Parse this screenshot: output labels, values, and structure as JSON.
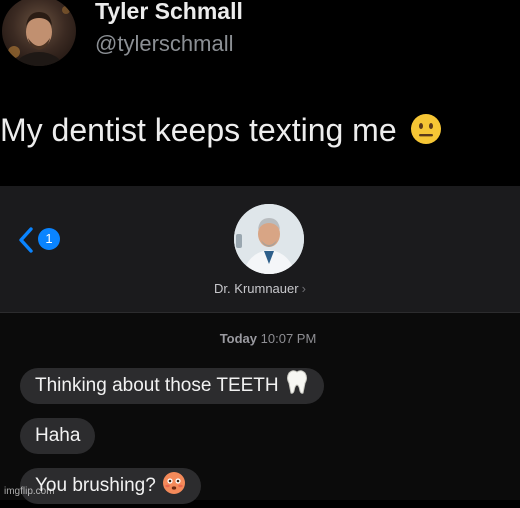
{
  "tweet": {
    "author_name": "Tyler Schmall",
    "author_handle": "@tylerschmall",
    "text": "My dentist keeps texting me",
    "emoji": "neutral-face-icon"
  },
  "messages": {
    "back_badge_count": "1",
    "contact_name": "Dr. Krumnauer",
    "contact_chevron": "›",
    "timestamp_day": "Today",
    "timestamp_time": "10:07 PM",
    "bubbles": [
      {
        "text": "Thinking about those TEETH",
        "emoji": "tooth-icon"
      },
      {
        "text": "Haha"
      },
      {
        "text": "You brushing?",
        "emoji": "flushed-face-icon"
      }
    ]
  },
  "watermark": "imgflip.com",
  "colors": {
    "background": "#000000",
    "header_bar": "#1b1b1d",
    "bubble": "#2c2c2e",
    "accent": "#0a84ff",
    "handle_gray": "#8b8f94"
  }
}
